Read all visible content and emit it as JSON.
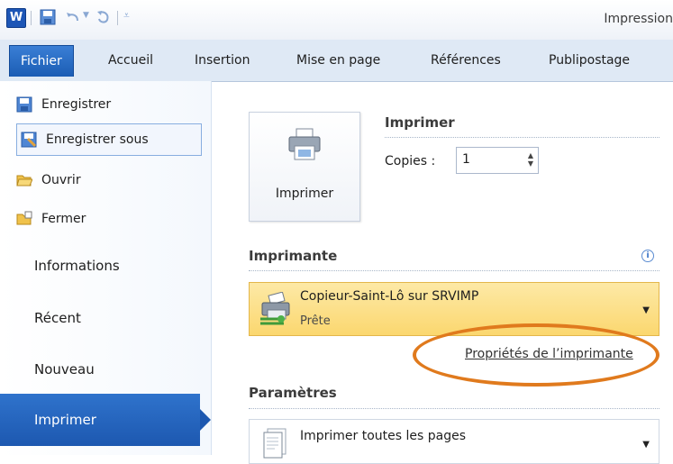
{
  "titlebar": {
    "title": "Impression"
  },
  "ribbon_tabs": [
    "Fichier",
    "Accueil",
    "Insertion",
    "Mise en page",
    "Références",
    "Publipostage"
  ],
  "backstage": {
    "commands": [
      {
        "label": "Enregistrer",
        "icon": "save-icon"
      },
      {
        "label": "Enregistrer sous",
        "icon": "save-as-icon"
      },
      {
        "label": "Ouvrir",
        "icon": "open-folder-icon"
      },
      {
        "label": "Fermer",
        "icon": "close-folder-icon"
      }
    ],
    "sections": [
      "Informations",
      "Récent",
      "Nouveau",
      "Imprimer"
    ],
    "selected_command": "Enregistrer sous",
    "active_section": "Imprimer"
  },
  "print": {
    "button_label": "Imprimer",
    "heading": "Imprimer",
    "copies_label": "Copies :",
    "copies_value": "1"
  },
  "printer": {
    "heading": "Imprimante",
    "name": "Copieur-Saint-Lô sur SRVIMP",
    "status": "Prête",
    "properties_link": "Propriétés de l’imprimante"
  },
  "settings": {
    "heading": "Paramètres",
    "pages_option": "Imprimer toutes les pages"
  },
  "colors": {
    "file_tab": "#1b5cb4",
    "active_section": "#1d58b0",
    "printer_highlight": "#fbd76f",
    "annotation_ellipse": "#e07a1d"
  }
}
